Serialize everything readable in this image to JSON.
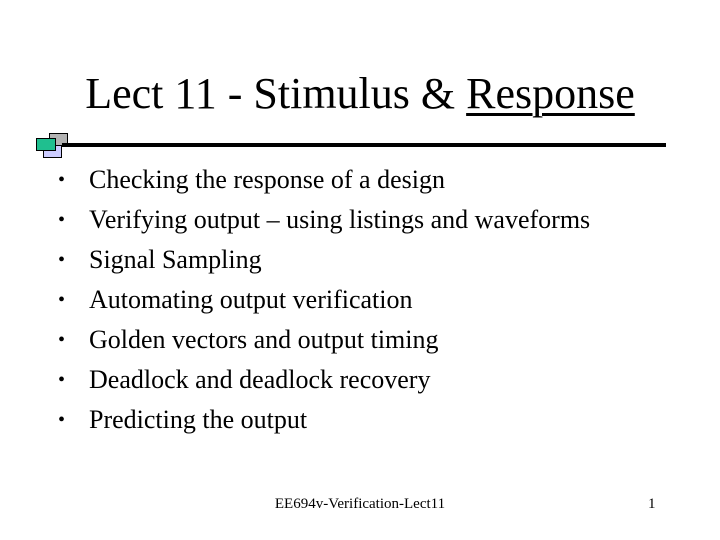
{
  "slide": {
    "title_prefix": "Lect 11 - Stimulus & ",
    "title_underlined": "Response",
    "logo_colors": {
      "gray": "#b3b3b3",
      "green": "#1fbf8f",
      "lavender": "#ccccff"
    },
    "bullets": [
      "Checking the response of a design",
      "Verifying output – using listings and waveforms",
      "Signal Sampling",
      "Automating output verification",
      "Golden vectors and output timing",
      "Deadlock and deadlock recovery",
      "Predicting the output"
    ],
    "bullet_glyph": "•",
    "footer": "EE694v-Verification-Lect11",
    "page_number": "1"
  }
}
